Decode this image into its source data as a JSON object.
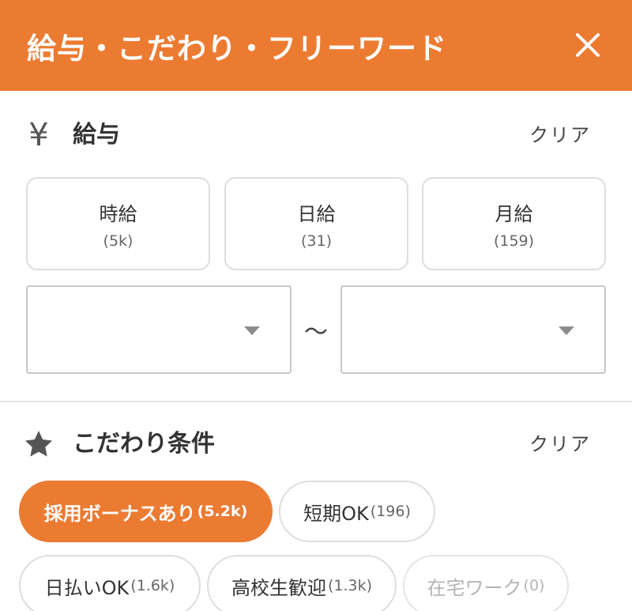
{
  "header": {
    "title": "給与・こだわり・フリーワード",
    "close_icon": "close-icon",
    "background": "#ec7b32"
  },
  "salary": {
    "icon": "yen-icon",
    "icon_glyph": "¥",
    "title": "給与",
    "clear_label": "クリア",
    "types": [
      {
        "label": "時給",
        "count": "(5k)"
      },
      {
        "label": "日給",
        "count": "(31)"
      },
      {
        "label": "月給",
        "count": "(159)"
      }
    ],
    "range_min_value": "",
    "range_max_value": "",
    "range_separator": "〜"
  },
  "preferences": {
    "icon": "star-icon",
    "title": "こだわり条件",
    "clear_label": "クリア",
    "chips": [
      {
        "label": "採用ボーナスあり",
        "count": "(5.2k)",
        "state": "selected"
      },
      {
        "label": "短期OK",
        "count": "(196)",
        "state": "default"
      },
      {
        "label": "日払いOK",
        "count": "(1.6k)",
        "state": "default"
      },
      {
        "label": "高校生歓迎",
        "count": "(1.3k)",
        "state": "default"
      },
      {
        "label": "在宅ワーク",
        "count": "(0)",
        "state": "disabled"
      }
    ]
  },
  "colors": {
    "accent": "#ec7b32",
    "text": "#333333",
    "border": "#dddddd"
  }
}
